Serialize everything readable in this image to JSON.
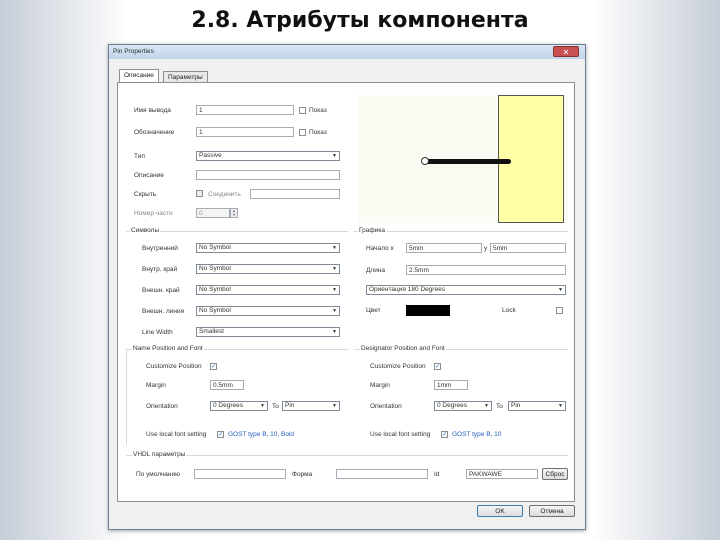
{
  "slide": {
    "title": "2.8. Атрибуты компонента"
  },
  "dialog": {
    "title": "Pin Properties",
    "close_label": "✕",
    "tabs": [
      {
        "label": "Описание"
      },
      {
        "label": "Параметры"
      }
    ]
  },
  "description": {
    "display_name": {
      "label": "Имя вывода",
      "value": "1",
      "checkbox_label": "Показ"
    },
    "designator": {
      "label": "Обозначение",
      "value": "1",
      "checkbox_label": "Показ"
    },
    "type": {
      "label": "Тип",
      "value": "Passive"
    },
    "description": {
      "label": "Описание",
      "value": ""
    },
    "hide": {
      "label": "Скрыть",
      "checkbox_label": "Соединить",
      "value": ""
    },
    "part_number": {
      "label": "Номер части",
      "value": "0"
    }
  },
  "symbols": {
    "title": "Символы",
    "inside": {
      "label": "Внутренний",
      "value": "No Symbol"
    },
    "inside_edge": {
      "label": "Внутр. край",
      "value": "No Symbol"
    },
    "outside_edge": {
      "label": "Внешн. край",
      "value": "No Symbol"
    },
    "outside": {
      "label": "Внешн. линия",
      "value": "No Symbol"
    },
    "line_width": {
      "label": "Line Width",
      "value": "Smallest"
    }
  },
  "graphics": {
    "title": "Графика",
    "location_x": {
      "label": "Начало  x",
      "value": "5mm"
    },
    "location_y": {
      "label": "y",
      "value": "5mm"
    },
    "length": {
      "label": "Длина",
      "value": "2.5mm"
    },
    "orientation": {
      "label": "Ориентация",
      "value": "180 Degrees"
    },
    "color": {
      "label": "Цвет",
      "value": "#000000"
    },
    "locked": {
      "label": "Lock"
    }
  },
  "name_font": {
    "title": "Name Position and Font",
    "customize": {
      "label": "Customize Position",
      "checked": "✓"
    },
    "margin": {
      "label": "Margin",
      "value": "0.5mm"
    },
    "orientation": {
      "label": "Orientation",
      "value": "0 Degrees",
      "to_label": "To",
      "to_value": "Pin"
    },
    "font": {
      "label": "Use local font setting",
      "checked": "✓",
      "link": "GOST type B, 10, Bold"
    }
  },
  "designator_font": {
    "title": "Designator Position and Font",
    "customize": {
      "label": "Customize Position",
      "checked": "✓"
    },
    "margin": {
      "label": "Margin",
      "value": "1mm"
    },
    "orientation": {
      "label": "Orientation",
      "value": "0 Degrees",
      "to_label": "To",
      "to_value": "Pin"
    },
    "font": {
      "label": "Use local font setting",
      "checked": "✓",
      "link": "GOST type B, 10"
    }
  },
  "vhdl": {
    "title": "VHDL параметры",
    "default_label": "По умолчанию",
    "default_value": "",
    "form_label": "Форма",
    "form_value": "",
    "id_label": "Id",
    "id_value": "PAKWAWE",
    "button_label": "Сброс"
  },
  "buttons": {
    "ok": "OK",
    "cancel": "Отмена"
  }
}
